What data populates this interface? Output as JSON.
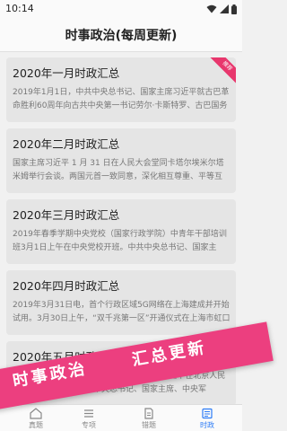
{
  "status_bar": {
    "time": "10:14"
  },
  "header": {
    "title": "时事政治(每周更新)"
  },
  "cards": [
    {
      "title": "2020年一月时政汇总",
      "desc": "2019年1月1日，中共中央总书记、国家主席习近平就古巴革命胜利60周年向古共中央第一书记劳尔·卡斯特罗、古巴国务",
      "badge": "推荐"
    },
    {
      "title": "2020年二月时政汇总",
      "desc": "国家主席习近平 1 月 31 日在人民大会堂同卡塔尔埃米尔塔米姆举行会谈。两国元首一致同意，深化相互尊重、平等互"
    },
    {
      "title": "2020年三月时政汇总",
      "desc": "2019年春季学期中央党校（国家行政学院）中青年干部培训班3月1日上午在中央党校开班。中共中央总书记、国家主"
    },
    {
      "title": "2020年四月时政汇总",
      "desc": "2019年3月31日电，首个行政区域5G网络在上海建成并开始试用。3月30日上午，“双千兆第一区”开通仪式在上海市虹口"
    },
    {
      "title": "2020年五月时政汇总",
      "desc": "纪念五四运动100周年大会2019年4月30日上午在北京人民大会堂隆重举行。中共中央总书记、国家主席、中央军"
    }
  ],
  "tabs": [
    {
      "label": "真题",
      "icon": "home-icon"
    },
    {
      "label": "专项",
      "icon": "list-icon"
    },
    {
      "label": "错题",
      "icon": "document-icon"
    },
    {
      "label": "时政",
      "icon": "news-icon"
    }
  ],
  "promo": {
    "left": "时事政治",
    "right": "汇总更新"
  },
  "colors": {
    "accent": "#2d7cf6",
    "promo": "#ec3f7f",
    "badge": "#e8376d"
  }
}
